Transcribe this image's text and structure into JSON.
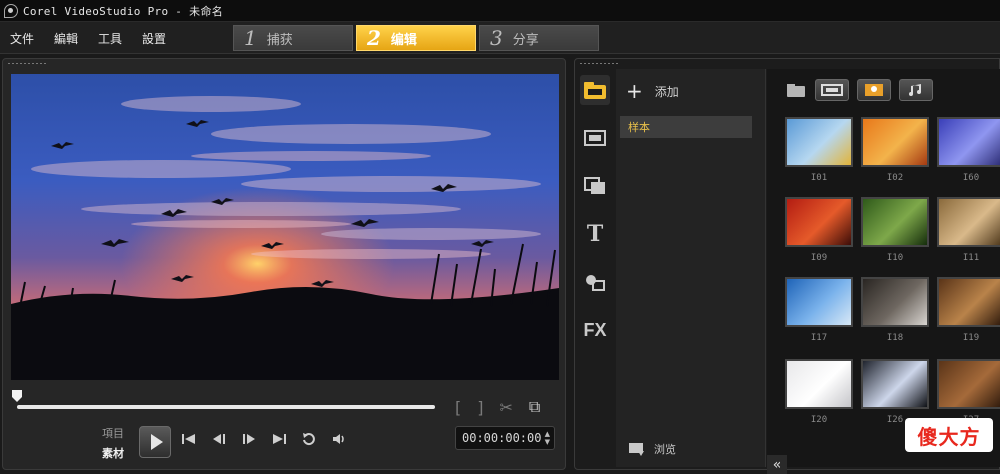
{
  "window": {
    "title": "Corel VideoStudio Pro - 未命名"
  },
  "menu": [
    "文件",
    "編輯",
    "工具",
    "設置"
  ],
  "steps": [
    {
      "num": "1",
      "label": "捕获"
    },
    {
      "num": "2",
      "label": "编辑"
    },
    {
      "num": "3",
      "label": "分享"
    }
  ],
  "steps_active": 1,
  "preview": {
    "progress": 0,
    "mode": {
      "project": "項目",
      "clip": "素材"
    },
    "timecode": "00:00:00:00"
  },
  "library": {
    "add_label": "添加",
    "folder": "样本",
    "browse_label": "浏览",
    "collapse": "«",
    "thumbnails": [
      {
        "label": "I01",
        "colors": [
          "#5a9ad6",
          "#b6d7f0",
          "#e2b43a"
        ]
      },
      {
        "label": "I02",
        "colors": [
          "#e8781a",
          "#f3b34b",
          "#a43a12"
        ]
      },
      {
        "label": "I60",
        "colors": [
          "#3a3fb8",
          "#8f96f0",
          "#2a2a72"
        ]
      },
      {
        "label": "I09",
        "colors": [
          "#b31d12",
          "#e55a2a",
          "#3c0d08"
        ]
      },
      {
        "label": "I10",
        "colors": [
          "#2f5a1a",
          "#7ea84a",
          "#162e0c"
        ]
      },
      {
        "label": "I11",
        "colors": [
          "#8a6a3c",
          "#d9b98a",
          "#4a3418"
        ]
      },
      {
        "label": "I17",
        "colors": [
          "#1f64b8",
          "#7bb3ec",
          "#d8e8f6"
        ]
      },
      {
        "label": "I18",
        "colors": [
          "#2a2623",
          "#6e6760",
          "#d8d4d0"
        ]
      },
      {
        "label": "I19",
        "colors": [
          "#5a3418",
          "#b9834a",
          "#2b170a"
        ]
      },
      {
        "label": "I20",
        "colors": [
          "#e8e8ea",
          "#ffffff",
          "#c5c5c9"
        ]
      },
      {
        "label": "I26",
        "colors": [
          "#20242e",
          "#cdd6ea",
          "#0f1116"
        ]
      },
      {
        "label": "I27",
        "colors": [
          "#5a3418",
          "#a56a3a",
          "#2b170a"
        ]
      }
    ]
  },
  "watermark": "傻大方",
  "colors": {
    "accent": "#f2bd2f",
    "folder_text": "#e9c04a"
  }
}
